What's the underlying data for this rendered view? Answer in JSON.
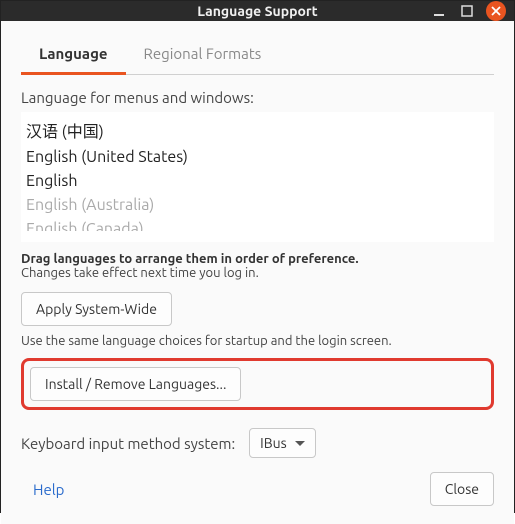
{
  "window": {
    "title": "Language Support"
  },
  "tabs": {
    "language": "Language",
    "regional": "Regional Formats"
  },
  "labels": {
    "menus_windows": "Language for menus and windows:",
    "drag_hint": "Drag languages to arrange them in order of preference.",
    "effect_hint": "Changes take effect next time you log in.",
    "same_choices": "Use the same language choices for startup and the login screen.",
    "keyboard_input": "Keyboard input method system:"
  },
  "languages": {
    "0": "汉语 (中国)",
    "1": "English (United States)",
    "2": "English",
    "3": "English (Australia)",
    "4": "English (Canada)"
  },
  "buttons": {
    "apply": "Apply System-Wide",
    "install": "Install / Remove Languages...",
    "help": "Help",
    "close": "Close"
  },
  "combo": {
    "ibus": "IBus"
  }
}
